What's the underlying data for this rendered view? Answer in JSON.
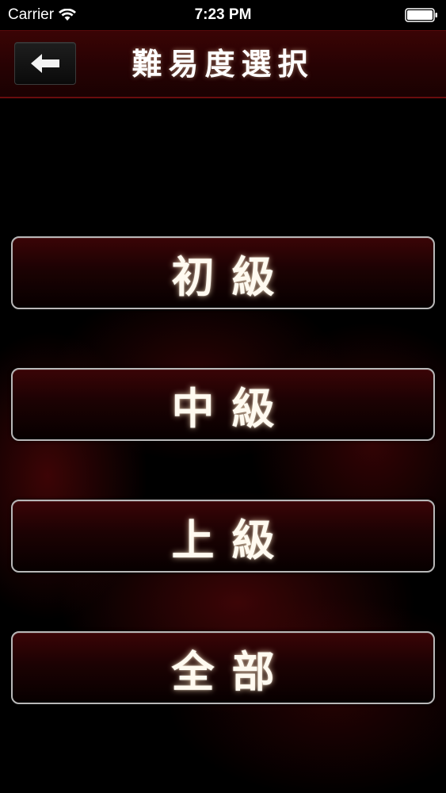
{
  "status_bar": {
    "carrier": "Carrier",
    "time": "7:23 PM",
    "icons": [
      "wifi-icon",
      "battery-icon"
    ]
  },
  "nav": {
    "title": "難易度選択",
    "back_icon": "back-arrow-icon"
  },
  "difficulties": [
    {
      "label": "初級"
    },
    {
      "label": "中級"
    },
    {
      "label": "上級"
    },
    {
      "label": "全部"
    }
  ],
  "colors": {
    "nav_background": "#2a0304",
    "button_border": "#b8b8b8",
    "button_background": "#1c0203",
    "text": "#ffffff"
  }
}
